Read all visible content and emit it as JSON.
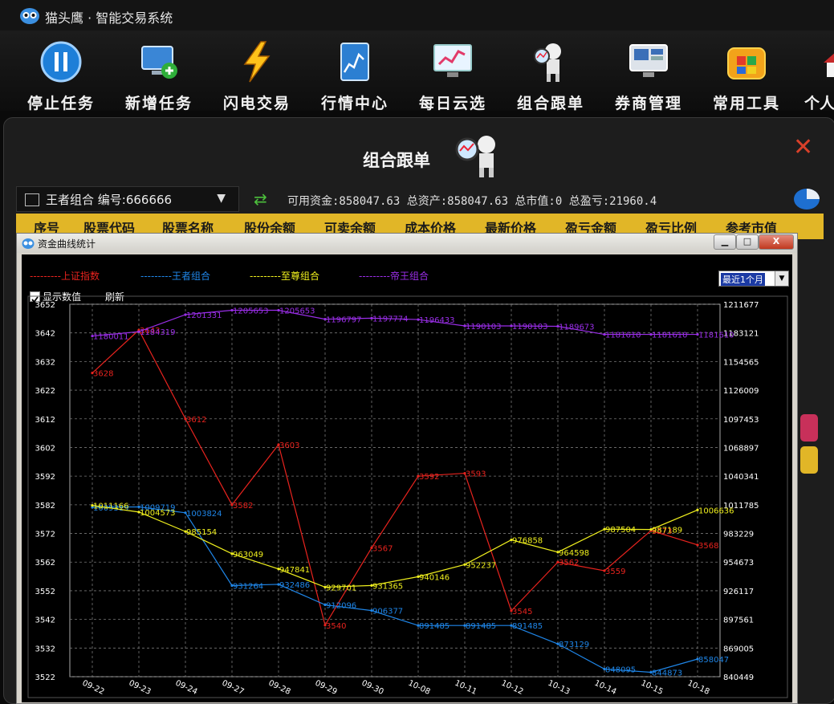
{
  "app": {
    "title": "猫头鹰 · 智能交易系统"
  },
  "toolbar": {
    "items": [
      {
        "label": "停止任务",
        "icon": "pause-icon"
      },
      {
        "label": "新增任务",
        "icon": "add-monitor-icon"
      },
      {
        "label": "闪电交易",
        "icon": "lightning-icon"
      },
      {
        "label": "行情中心",
        "icon": "market-chart-icon"
      },
      {
        "label": "每日云选",
        "icon": "daily-pick-icon"
      },
      {
        "label": "组合跟单",
        "icon": "follow-robot-icon"
      },
      {
        "label": "券商管理",
        "icon": "broker-monitor-icon"
      },
      {
        "label": "常用工具",
        "icon": "toolbox-icon"
      },
      {
        "label": "个人",
        "icon": "home-icon"
      }
    ]
  },
  "panel": {
    "title": "组合跟单",
    "close": "✕",
    "portfolio_select": "王者组合  编号:666666",
    "summary": "可用资金:858047.63 总资产:858047.63 总市值:0 总盈亏:21960.4",
    "columns": [
      "序号",
      "股票代码",
      "股票名称",
      "股份余额",
      "可卖余额",
      "成本价格",
      "最新价格",
      "盈亏金额",
      "盈亏比例",
      "参考市值"
    ]
  },
  "dialog": {
    "title": "资金曲线统计",
    "btn_min": "▁",
    "btn_max": "□",
    "btn_close": "X",
    "range_select": "最近1个月",
    "show_values_label": "显示数值",
    "refresh_label": "刷新"
  },
  "colors": {
    "red": "#e8231e",
    "blue": "#1f86e8",
    "yellow": "#f0f01e",
    "purple": "#9a2ee8",
    "header_gold": "#e1b627"
  },
  "chart_data": {
    "type": "line",
    "categories": [
      "09-22",
      "09-23",
      "09-24",
      "09-27",
      "09-28",
      "09-29",
      "09-30",
      "10-08",
      "10-11",
      "10-12",
      "10-13",
      "10-14",
      "10-15",
      "10-18"
    ],
    "y_left_ticks": [
      "3652",
      "3642",
      "3632",
      "3622",
      "3612",
      "3602",
      "3592",
      "3582",
      "3572",
      "3562",
      "3552",
      "3542",
      "3532",
      "3522"
    ],
    "y_right_ticks": [
      "1211677",
      "1183121",
      "1154565",
      "1126009",
      "1097453",
      "1068897",
      "1040341",
      "1011785",
      "983229",
      "954673",
      "926117",
      "897561",
      "869005",
      "840449"
    ],
    "y_left_range": [
      3522,
      3652
    ],
    "y_right_range": [
      840449,
      1211677
    ],
    "grid": true,
    "series": [
      {
        "name": "上证指数",
        "axis": "left",
        "color": "#e8231e",
        "values": [
          3628,
          3643,
          3612,
          3582,
          3603,
          3540,
          3567,
          3592,
          3593,
          3545,
          3562,
          3559,
          3573,
          3568
        ]
      },
      {
        "name": "王者组合",
        "axis": "right",
        "color": "#1f86e8",
        "values": [
          1009319,
          1009719,
          1003824,
          931264,
          932486,
          912096,
          906377,
          891485,
          891485,
          891485,
          873129,
          848095,
          844873,
          858047
        ]
      },
      {
        "name": "至尊组合",
        "axis": "right",
        "color": "#f0f01e",
        "values": [
          1011166,
          1004573,
          985154,
          963049,
          947841,
          929701,
          931365,
          940146,
          952237,
          976858,
          964598,
          987504,
          987189,
          1006636
        ]
      },
      {
        "name": "帝王组合",
        "axis": "right",
        "color": "#9a2ee8",
        "values": [
          1180011,
          1184319,
          1201331,
          1205653,
          1205653,
          1196797,
          1197774,
          1196433,
          1190103,
          1190103,
          1189673,
          1181610,
          1181610,
          1181610
        ]
      }
    ]
  }
}
